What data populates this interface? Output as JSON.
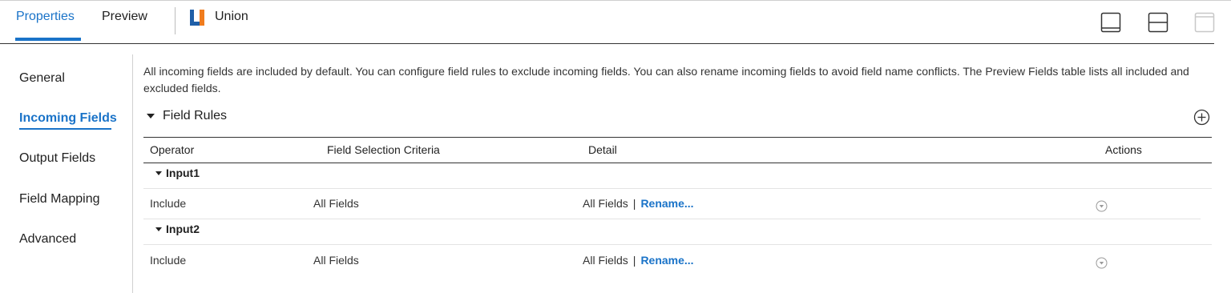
{
  "header": {
    "tabs": [
      {
        "label": "Properties",
        "active": true
      },
      {
        "label": "Preview",
        "active": false
      }
    ],
    "object_icon": "union-icon",
    "object_name": "Union",
    "layout_buttons": [
      "layout-bottom-panel-icon",
      "layout-split-panel-icon",
      "layout-top-panel-icon"
    ]
  },
  "nav": {
    "items": [
      {
        "label": "General",
        "active": false
      },
      {
        "label": "Incoming Fields",
        "active": true
      },
      {
        "label": "Output Fields",
        "active": false
      },
      {
        "label": "Field Mapping",
        "active": false
      },
      {
        "label": "Advanced",
        "active": false
      }
    ]
  },
  "content": {
    "description": "All incoming fields are included by default. You can configure field rules to exclude incoming fields. You can also rename incoming fields to avoid field name conflicts. The Preview Fields table lists all included and excluded fields.",
    "section_title": "Field Rules",
    "table": {
      "columns": [
        "Operator",
        "Field Selection Criteria",
        "Detail",
        "Actions"
      ],
      "groups": [
        {
          "name": "Input1",
          "rows": [
            {
              "operator": "Include",
              "criteria": "All Fields",
              "detail": "All Fields",
              "separator": "|",
              "link": "Rename..."
            }
          ]
        },
        {
          "name": "Input2",
          "rows": [
            {
              "operator": "Include",
              "criteria": "All Fields",
              "detail": "All Fields",
              "separator": "|",
              "link": "Rename..."
            }
          ]
        }
      ]
    }
  },
  "colors": {
    "accent": "#1a73c8",
    "union_blue": "#1f5fa8",
    "union_orange": "#f07c1e"
  }
}
